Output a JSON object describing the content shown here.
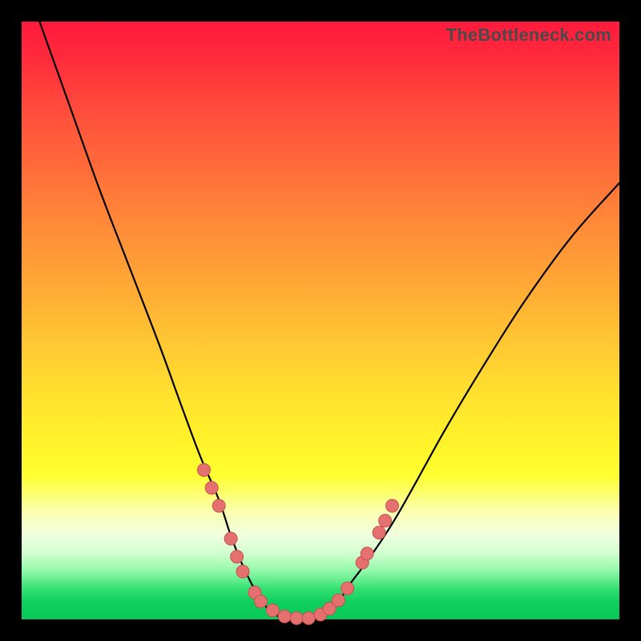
{
  "watermark": "TheBottleneck.com",
  "colors": {
    "frame": "#000000",
    "curve": "#000000",
    "dot_fill": "#e4706f",
    "dot_stroke": "#c8504f"
  },
  "chart_data": {
    "type": "line",
    "title": "",
    "xlabel": "",
    "ylabel": "",
    "xlim": [
      0,
      100
    ],
    "ylim": [
      0,
      100
    ],
    "grid": false,
    "legend": false,
    "series": [
      {
        "name": "bottleneck-curve",
        "x": [
          3,
          8,
          13,
          18,
          23,
          27,
          30,
          33,
          35,
          37,
          39,
          41,
          43,
          45,
          47,
          49,
          51,
          53,
          55,
          58,
          62,
          66,
          71,
          77,
          84,
          92,
          100
        ],
        "y": [
          100,
          86,
          72,
          59,
          46,
          35,
          27,
          20,
          14,
          9,
          5,
          2,
          0.5,
          0,
          0,
          0.5,
          1.5,
          3,
          6,
          10,
          16,
          23,
          32,
          42,
          53,
          64,
          73
        ]
      }
    ],
    "markers": [
      {
        "x": 30.5,
        "y": 25
      },
      {
        "x": 31.8,
        "y": 22
      },
      {
        "x": 33.0,
        "y": 19
      },
      {
        "x": 35.0,
        "y": 13.5
      },
      {
        "x": 36.0,
        "y": 10.5
      },
      {
        "x": 37.0,
        "y": 8
      },
      {
        "x": 39.0,
        "y": 4.5
      },
      {
        "x": 40.0,
        "y": 3
      },
      {
        "x": 42.0,
        "y": 1.5
      },
      {
        "x": 44.0,
        "y": 0.5
      },
      {
        "x": 46.0,
        "y": 0.2
      },
      {
        "x": 48.0,
        "y": 0.2
      },
      {
        "x": 50.0,
        "y": 0.8
      },
      {
        "x": 51.5,
        "y": 1.8
      },
      {
        "x": 53.0,
        "y": 3.2
      },
      {
        "x": 54.5,
        "y": 5.2
      },
      {
        "x": 57.0,
        "y": 9.5
      },
      {
        "x": 57.8,
        "y": 11
      },
      {
        "x": 59.8,
        "y": 14.5
      },
      {
        "x": 60.8,
        "y": 16.5
      },
      {
        "x": 62.0,
        "y": 19
      }
    ],
    "marker_radius_px": 8
  }
}
